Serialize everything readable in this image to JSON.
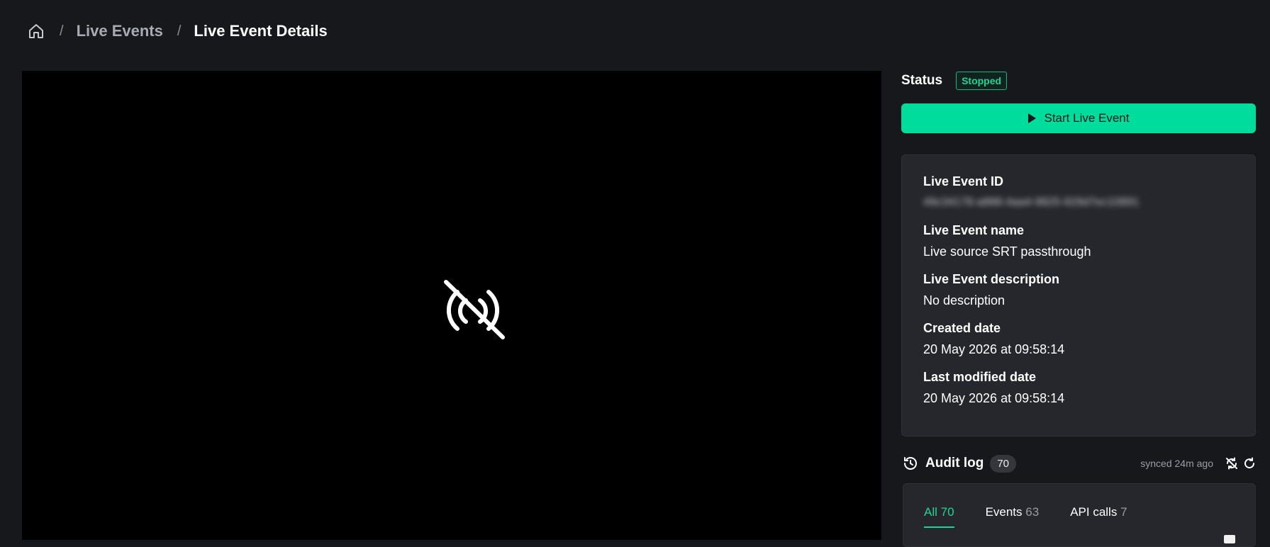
{
  "breadcrumb": {
    "home_icon": "home-icon",
    "separator": "/",
    "link_label": "Live Events",
    "current_label": "Live Event Details"
  },
  "player": {
    "icon": "no-signal-icon"
  },
  "status": {
    "label": "Status",
    "value": "Stopped",
    "badge_color": "#1fd596"
  },
  "start_button": {
    "label": "Start Live Event",
    "icon": "play-icon",
    "color": "#00dc9b"
  },
  "details": {
    "fields": [
      {
        "label": "Live Event ID",
        "value": "49c34178-a888-4aa4-9825-929d7ec10891"
      },
      {
        "label": "Live Event name",
        "value": "Live source SRT passthrough"
      },
      {
        "label": "Live Event description",
        "value": "No description"
      },
      {
        "label": "Created date",
        "value": "20 May 2026 at 09:58:14"
      },
      {
        "label": "Last modified date",
        "value": "20 May 2026 at 09:58:14"
      }
    ]
  },
  "audit_log": {
    "icon": "history-icon",
    "title": "Audit log",
    "count": "70",
    "synced": "synced 24m ago",
    "tools": [
      "sync-off-icon",
      "refresh-icon"
    ],
    "tabs": [
      {
        "label": "All",
        "count": "70",
        "active": true
      },
      {
        "label": "Events",
        "count": "63",
        "active": false
      },
      {
        "label": "API calls",
        "count": "7",
        "active": false
      }
    ]
  }
}
